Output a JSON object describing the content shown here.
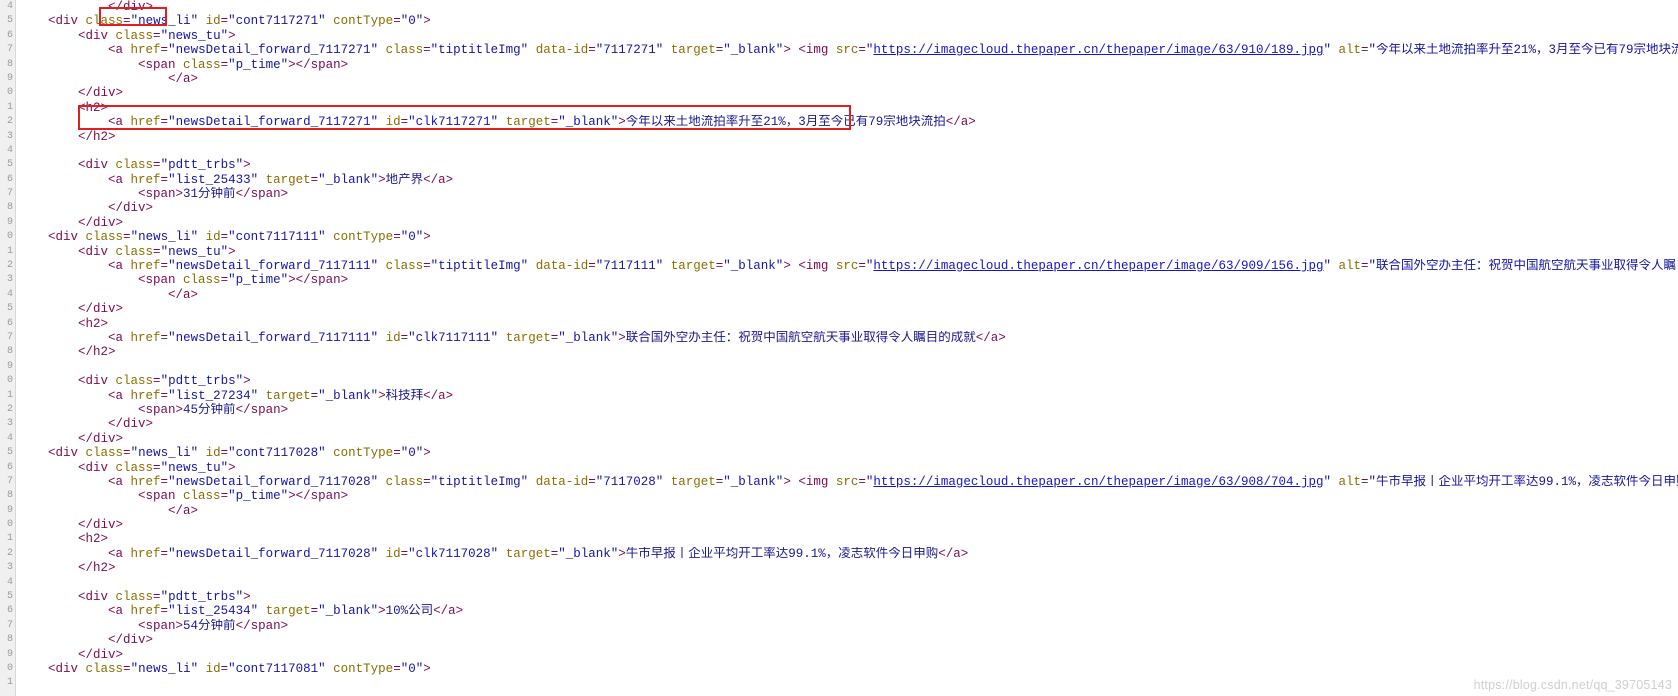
{
  "view": {
    "kind": "html-source-code-view",
    "language": "HTML",
    "watermark": "https://blog.csdn.net/qq_39705143"
  },
  "colors": {
    "background": "#ffffff",
    "gutter_background": "#f0f0f0",
    "line_number": "#9a9a9a",
    "tag": "#7b0a52",
    "attribute": "#8a6d00",
    "string": "#1515a0",
    "text": "#1a1a8c",
    "link": "#1515d0",
    "highlight_box": "#e02020",
    "watermark": "#cfcfcf"
  },
  "annotations": [
    {
      "name": "class-attribute-highlight",
      "target": "\"news_li\""
    },
    {
      "name": "title-anchor-highlight",
      "target": "<a href=\"newsDetail_forward_7117271\" id=\"clk7117271\" target=\"_blank\">今年以来土地流拍率升至21%，3月至今已有79宗地块流拍</a>"
    }
  ],
  "line_numbers": [
    "4",
    "5",
    "6",
    "7",
    "8",
    "9",
    "0",
    "1",
    "2",
    "3",
    "4",
    "5",
    "6",
    "7",
    "8",
    "9",
    "0",
    "1",
    "2",
    "3",
    "4",
    "5",
    "6",
    "7",
    "8",
    "9",
    "0",
    "1",
    "2",
    "3",
    "4",
    "5",
    "6",
    "7",
    "8",
    "9",
    "0",
    "1",
    "2",
    "3",
    "4",
    "5",
    "6",
    "7",
    "8",
    "9",
    "0",
    "1"
  ],
  "news_items": [
    {
      "cont_id": "cont7117271",
      "cont_type": "0",
      "forward_href": "newsDetail_forward_7117271",
      "data_id": "7117271",
      "click_id": "clk7117271",
      "image_src": "https://imagecloud.thepaper.cn/thepaper/image/63/910/189.jpg",
      "title": "今年以来土地流拍率升至21%，3月至今已有79宗地块流拍",
      "channel_href": "list_25433",
      "channel": "地产界",
      "time": "31分钟前"
    },
    {
      "cont_id": "cont7117111",
      "cont_type": "0",
      "forward_href": "newsDetail_forward_7117111",
      "data_id": "7117111",
      "click_id": "clk7117111",
      "image_src": "https://imagecloud.thepaper.cn/thepaper/image/63/909/156.jpg",
      "title": "联合国外空办主任：祝贺中国航空航天事业取得令人瞩目的成就",
      "channel_href": "list_27234",
      "channel": "科技拜",
      "time": "45分钟前"
    },
    {
      "cont_id": "cont7117028",
      "cont_type": "0",
      "forward_href": "newsDetail_forward_7117028",
      "data_id": "7117028",
      "click_id": "clk7117028",
      "image_src": "https://imagecloud.thepaper.cn/thepaper/image/63/908/704.jpg",
      "title": "牛市早报丨企业平均开工率达99.1%，凌志软件今日申购",
      "channel_href": "list_25434",
      "channel": "10%公司",
      "time": "54分钟前"
    },
    {
      "cont_id": "cont7117081",
      "cont_type": "0"
    }
  ],
  "lines": [
    {
      "n": 1,
      "indent": 3,
      "type": "close-div-partial"
    },
    {
      "n": 2,
      "indent": 1,
      "type": "open-news-li",
      "item": 0
    },
    {
      "n": 3,
      "indent": 2,
      "type": "open-news-tu"
    },
    {
      "n": 4,
      "indent": 3,
      "type": "img-anchor",
      "item": 0
    },
    {
      "n": 5,
      "indent": 4,
      "type": "p-time-span"
    },
    {
      "n": 6,
      "indent": 5,
      "type": "close-a"
    },
    {
      "n": 7,
      "indent": 2,
      "type": "close-div"
    },
    {
      "n": 8,
      "indent": 2,
      "type": "open-h2"
    },
    {
      "n": 9,
      "indent": 3,
      "type": "title-anchor",
      "item": 0
    },
    {
      "n": 10,
      "indent": 2,
      "type": "close-h2"
    },
    {
      "n": 11,
      "indent": 0,
      "type": "blank"
    },
    {
      "n": 12,
      "indent": 2,
      "type": "open-pdtt"
    },
    {
      "n": 13,
      "indent": 3,
      "type": "channel-anchor",
      "item": 0
    },
    {
      "n": 14,
      "indent": 4,
      "type": "time-span",
      "item": 0
    },
    {
      "n": 15,
      "indent": 3,
      "type": "close-div"
    },
    {
      "n": 16,
      "indent": 2,
      "type": "close-div"
    },
    {
      "n": 17,
      "indent": 1,
      "type": "open-news-li",
      "item": 1
    },
    {
      "n": 18,
      "indent": 2,
      "type": "open-news-tu"
    },
    {
      "n": 19,
      "indent": 3,
      "type": "img-anchor",
      "item": 1
    },
    {
      "n": 20,
      "indent": 4,
      "type": "p-time-span"
    },
    {
      "n": 21,
      "indent": 5,
      "type": "close-a"
    },
    {
      "n": 22,
      "indent": 2,
      "type": "close-div"
    },
    {
      "n": 23,
      "indent": 2,
      "type": "open-h2"
    },
    {
      "n": 24,
      "indent": 3,
      "type": "title-anchor",
      "item": 1
    },
    {
      "n": 25,
      "indent": 2,
      "type": "close-h2"
    },
    {
      "n": 26,
      "indent": 0,
      "type": "blank"
    },
    {
      "n": 27,
      "indent": 2,
      "type": "open-pdtt"
    },
    {
      "n": 28,
      "indent": 3,
      "type": "channel-anchor",
      "item": 1
    },
    {
      "n": 29,
      "indent": 4,
      "type": "time-span",
      "item": 1
    },
    {
      "n": 30,
      "indent": 3,
      "type": "close-div"
    },
    {
      "n": 31,
      "indent": 2,
      "type": "close-div"
    },
    {
      "n": 32,
      "indent": 1,
      "type": "open-news-li",
      "item": 2
    },
    {
      "n": 33,
      "indent": 2,
      "type": "open-news-tu"
    },
    {
      "n": 34,
      "indent": 3,
      "type": "img-anchor",
      "item": 2
    },
    {
      "n": 35,
      "indent": 4,
      "type": "p-time-span"
    },
    {
      "n": 36,
      "indent": 5,
      "type": "close-a"
    },
    {
      "n": 37,
      "indent": 2,
      "type": "close-div"
    },
    {
      "n": 38,
      "indent": 2,
      "type": "open-h2"
    },
    {
      "n": 39,
      "indent": 3,
      "type": "title-anchor",
      "item": 2
    },
    {
      "n": 40,
      "indent": 2,
      "type": "close-h2"
    },
    {
      "n": 41,
      "indent": 0,
      "type": "blank"
    },
    {
      "n": 42,
      "indent": 2,
      "type": "open-pdtt"
    },
    {
      "n": 43,
      "indent": 3,
      "type": "channel-anchor",
      "item": 2
    },
    {
      "n": 44,
      "indent": 4,
      "type": "time-span",
      "item": 2
    },
    {
      "n": 45,
      "indent": 3,
      "type": "close-div"
    },
    {
      "n": 46,
      "indent": 2,
      "type": "close-div"
    },
    {
      "n": 47,
      "indent": 1,
      "type": "open-news-li",
      "item": 3
    }
  ],
  "snippets": {
    "close_div": "</div>",
    "close_a": "</a>",
    "close_h2": "</h2>",
    "open_h2": "<h2>",
    "p_time_span": "<span class=\"p_time\"></span>",
    "class_news_li": "news_li",
    "class_news_tu": "news_tu",
    "class_pdtt_trbs": "pdtt_trbs",
    "class_tiptitleImg": "tiptitleImg",
    "target_blank": "_blank",
    "attr_class": "class",
    "attr_id": "id",
    "attr_href": "href",
    "attr_src": "src",
    "attr_alt": "alt",
    "attr_target": "target",
    "attr_data_id": "data-id",
    "attr_contType": "contType"
  }
}
